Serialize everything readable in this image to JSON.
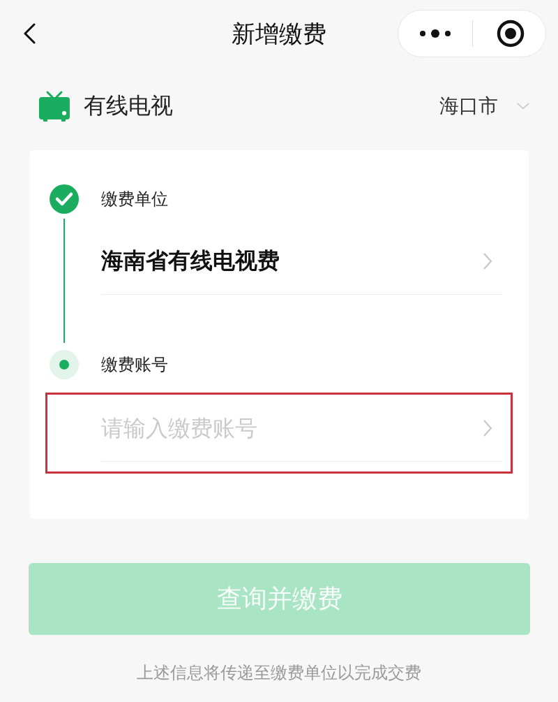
{
  "nav": {
    "title": "新增缴费"
  },
  "service": {
    "name": "有线电视",
    "city": "海口市"
  },
  "steps": [
    {
      "kind": "done",
      "label": "缴费单位",
      "value": "海南省有线电视费",
      "highlighted": false
    },
    {
      "kind": "current",
      "label": "缴费账号",
      "placeholder": "请输入缴费账号",
      "highlighted": true
    }
  ],
  "submit": {
    "label": "查询并缴费",
    "disabled": true
  },
  "notice": "上述信息将传递至缴费单位以完成交费"
}
